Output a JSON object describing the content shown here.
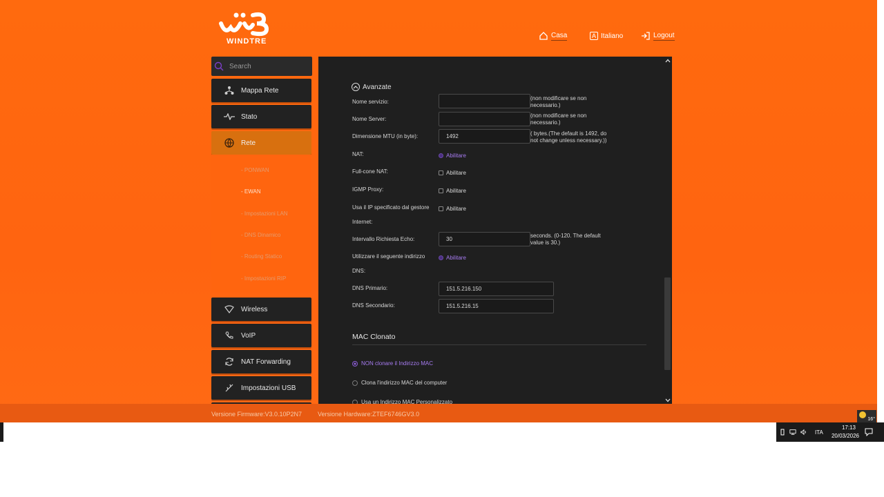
{
  "header": {
    "brand": "WINDTRE",
    "home_label": "Casa",
    "language_label": "Italiano",
    "language_icon_letter": "A",
    "logout_label": "Logout"
  },
  "sidebar": {
    "search_placeholder": "Search",
    "items": [
      {
        "label": "Mappa Rete",
        "icon": "network-map-icon"
      },
      {
        "label": "Stato",
        "icon": "pulse-icon"
      },
      {
        "label": "Rete",
        "icon": "globe-icon",
        "active": true
      },
      {
        "label": "Wireless",
        "icon": "wifi-icon"
      },
      {
        "label": "VoIP",
        "icon": "phone-icon"
      },
      {
        "label": "NAT Forwarding",
        "icon": "refresh-icon"
      },
      {
        "label": "Impostazioni USB",
        "icon": "usb-icon"
      }
    ],
    "submenu": [
      {
        "label": "- PONWAN"
      },
      {
        "label": "- EWAN",
        "active": true
      },
      {
        "label": "- Impostazioni LAN"
      },
      {
        "label": "- DNS Dinamico"
      },
      {
        "label": "- Routing Statico"
      },
      {
        "label": "- Impostazioni RIP"
      }
    ]
  },
  "main": {
    "section_title": "Avanzate",
    "fields": {
      "service_name": {
        "label": "Nome servizio:",
        "value": "",
        "note": "(non modificare se non necessario.)"
      },
      "server_name": {
        "label": "Nome Server:",
        "value": "",
        "note": "(non modificare se non necessario.)"
      },
      "mtu": {
        "label": "Dimensione MTU (in byte):",
        "value": "1492",
        "note": "( bytes.(The default is 1492, do not change unless necessary.))"
      },
      "nat": {
        "label": "NAT:",
        "option": "Abilitare",
        "checked": true
      },
      "full_cone_nat": {
        "label": "Full-cone NAT:",
        "option": "Abilitare",
        "checked": false
      },
      "igmp_proxy": {
        "label": "IGMP Proxy:",
        "option": "Abilitare",
        "checked": false
      },
      "isp_ip": {
        "label_line1": "Usa il IP specificato dal gestore",
        "label_line2": "Internet:",
        "option": "Abilitare",
        "checked": false
      },
      "echo_interval": {
        "label": "Intervallo Richiesta Echo:",
        "value": "30",
        "note": "seconds. (0-120. The default value is 30.)"
      },
      "use_dns": {
        "label_line1": "Utilizzare il seguente indirizzo",
        "label_line2": "DNS:",
        "option": "Abilitare",
        "checked": true
      },
      "dns_primary": {
        "label": "DNS Primario:",
        "value": "151.5.216.150"
      },
      "dns_secondary": {
        "label": "DNS Secondario:",
        "value": "151.5.216.15"
      }
    },
    "mac_clone": {
      "title": "MAC Clonato",
      "options": [
        {
          "label": "NON clonare il Indirizzo MAC",
          "selected": true
        },
        {
          "label": "Clona l'indirizzo MAC del computer",
          "selected": false
        },
        {
          "label": "Usa un Indirizzo MAC Personalizzato",
          "selected": false
        }
      ]
    }
  },
  "footer": {
    "firmware": "Versione Firmware:V3.0.10P2N7",
    "hardware": "Versione Hardware:ZTEF6746GV3.0"
  },
  "taskbar": {
    "weather_temp": "16°",
    "language": "ITA",
    "time": "17:13",
    "date": "20/03/2026"
  },
  "colors": {
    "brand_orange": "#ff6a0e",
    "panel_dark": "#1f1f1f",
    "active_menu": "#d8700f",
    "accent_purple": "#a67bf0"
  }
}
